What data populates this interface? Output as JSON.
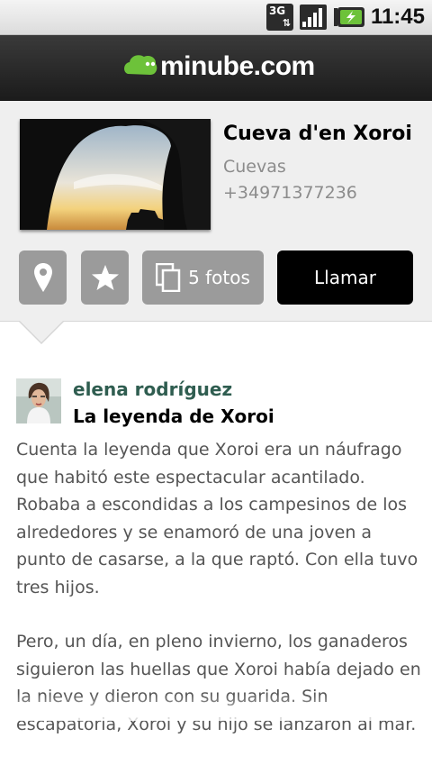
{
  "status_bar": {
    "network": "3G",
    "time": "11:45"
  },
  "header": {
    "logo_text": "minube.com"
  },
  "place": {
    "name": "Cueva d'en Xoroi",
    "category": "Cuevas",
    "phone": "+34971377236"
  },
  "actions": {
    "photos_label": "5 fotos",
    "call_label": "Llamar"
  },
  "review": {
    "author": "elena rodríguez",
    "title": "La leyenda de Xoroi",
    "paragraphs": [
      "Cuenta la leyenda que Xoroi era un náufrago que habitó este espectacular acantilado. Robaba a escondidas a los campesinos de los alrededores y se enamoró de una joven a punto de casarse, a la que raptó. Con ella tuvo tres hijos.",
      "Pero, un día, en pleno invierno, los ganaderos siguieron las huellas que Xoroi había dejado en la nieve y dieron con su guarida. Sin escapatoria, Xoroi y su hijo se lanzaron al mar."
    ]
  },
  "icons": {
    "map": "map-pin-icon",
    "favorite": "star-icon",
    "photos": "photos-icon"
  },
  "colors": {
    "brand_green": "#6dc23a",
    "author_color": "#2f5d50",
    "button_grey": "#9b9b9b",
    "call_button": "#000000"
  }
}
